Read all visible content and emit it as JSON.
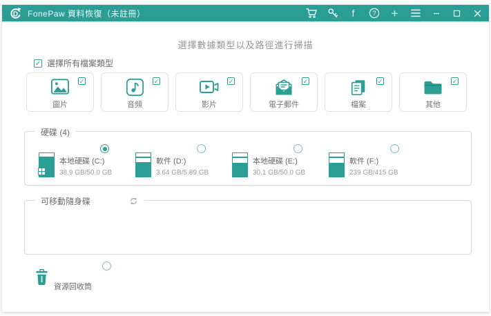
{
  "window": {
    "title": "FonePaw 資料恢復（未註冊）",
    "titlebar_icons": [
      "cart-icon",
      "register-key-icon",
      "facebook-icon",
      "help-icon",
      "add-icon",
      "menu-icon",
      "minimize-icon",
      "maximize-icon",
      "close-icon"
    ]
  },
  "glyphs": {
    "check": "✓",
    "facebook": "f",
    "plus": "+"
  },
  "header": {
    "title": "選擇數據類型以及路徑進行掃描"
  },
  "select_all": {
    "label": "選擇所有檔案類型",
    "checked": true
  },
  "file_types": [
    {
      "label": "圖片",
      "icon": "image-icon",
      "checked": true
    },
    {
      "label": "音頻",
      "icon": "audio-icon",
      "checked": true
    },
    {
      "label": "影片",
      "icon": "video-icon",
      "checked": true
    },
    {
      "label": "電子郵件",
      "icon": "email-icon",
      "checked": true
    },
    {
      "label": "檔案",
      "icon": "document-icon",
      "checked": true
    },
    {
      "label": "其他",
      "icon": "folder-icon",
      "checked": true
    }
  ],
  "hard_disk_section": {
    "title": "硬碟 (4)",
    "drives": [
      {
        "name": "本地硬碟 (C:)",
        "capacity": "38.9 GB/50.0 GB",
        "selected": true,
        "fill_percent": 78,
        "windows_logo": true
      },
      {
        "name": "軟件 (D:)",
        "capacity": "3.64 GB/5.89 GB",
        "selected": false,
        "fill_percent": 62,
        "windows_logo": false
      },
      {
        "name": "本地硬碟 (E:)",
        "capacity": "30.1 GB/50.0 GB",
        "selected": false,
        "fill_percent": 60,
        "windows_logo": false
      },
      {
        "name": "軟件 (F:)",
        "capacity": "239 GB/415 GB",
        "selected": false,
        "fill_percent": 58,
        "windows_logo": false
      }
    ]
  },
  "removable_section": {
    "title": "可移動隨身碟",
    "refresh_icon": "refresh-icon",
    "items": []
  },
  "recycle_bin": {
    "label": "資源回收筒",
    "selected": false
  },
  "colors": {
    "titlebar": "#2a9d95",
    "accent": "#2b9e96",
    "card_border": "#e3e3e3",
    "fieldset_border": "#d9d9d9"
  }
}
